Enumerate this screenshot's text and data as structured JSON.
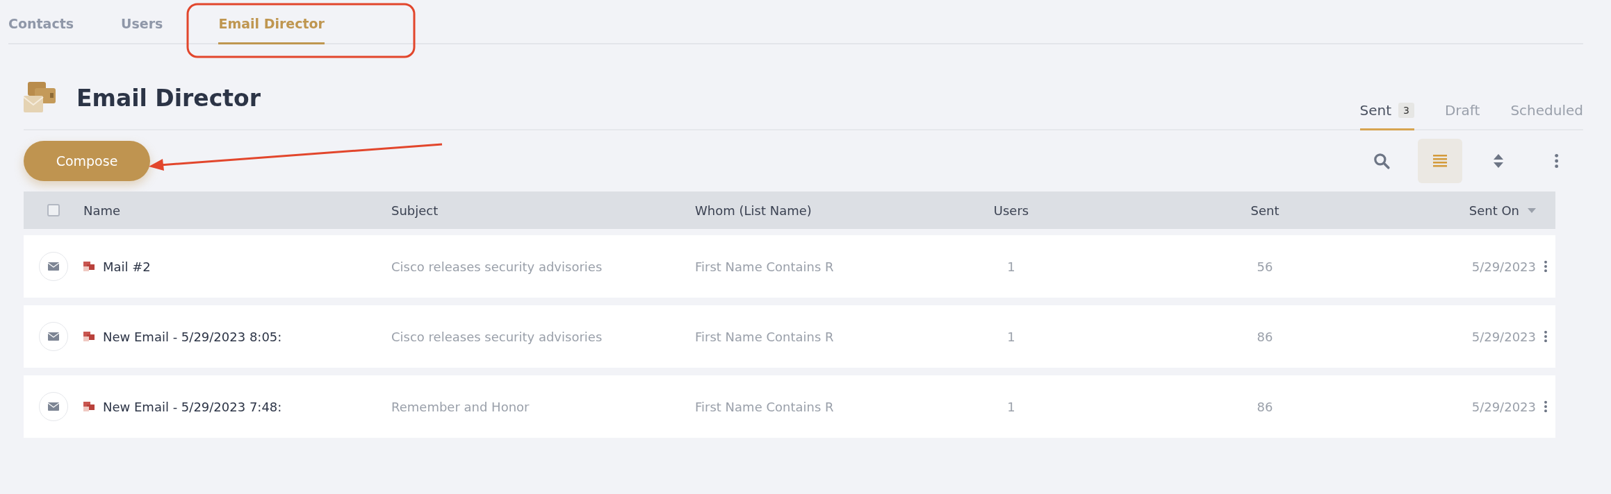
{
  "nav_tabs": [
    {
      "label": "Contacts",
      "selected": false
    },
    {
      "label": "Users",
      "selected": false
    },
    {
      "label": "Email Director",
      "selected": true
    }
  ],
  "page": {
    "title": "Email Director"
  },
  "status_tabs": [
    {
      "label": "Sent",
      "count": "3",
      "selected": true
    },
    {
      "label": "Draft",
      "selected": false
    },
    {
      "label": "Scheduled",
      "selected": false
    }
  ],
  "compose_button": "Compose",
  "toolbar": [
    {
      "kind": "search",
      "selected": false
    },
    {
      "kind": "list",
      "selected": true
    },
    {
      "kind": "sort",
      "selected": false
    },
    {
      "kind": "more",
      "selected": false
    }
  ],
  "table": {
    "select_all_checked": false,
    "columns": [
      {
        "label": "Name",
        "sorted": false
      },
      {
        "label": "Subject",
        "sorted": false
      },
      {
        "label": "Whom (List Name)",
        "sorted": false
      },
      {
        "label": "Users",
        "sorted": false
      },
      {
        "label": "Sent",
        "sorted": false
      },
      {
        "label": "Sent On",
        "sorted": true
      }
    ],
    "rows": [
      {
        "name": "Mail #2",
        "subject": "Cisco releases security advisories",
        "whom": "First Name Contains R",
        "users": "1",
        "sent": "56",
        "sent_on": "5/29/2023"
      },
      {
        "name": "New Email - 5/29/2023 8:05:",
        "subject": "Cisco releases security advisories",
        "whom": "First Name Contains R",
        "users": "1",
        "sent": "86",
        "sent_on": "5/29/2023"
      },
      {
        "name": "New Email - 5/29/2023 7:48:",
        "subject": "Remember and Honor",
        "whom": "First Name Contains R",
        "users": "1",
        "sent": "86",
        "sent_on": "5/29/2023"
      }
    ]
  }
}
